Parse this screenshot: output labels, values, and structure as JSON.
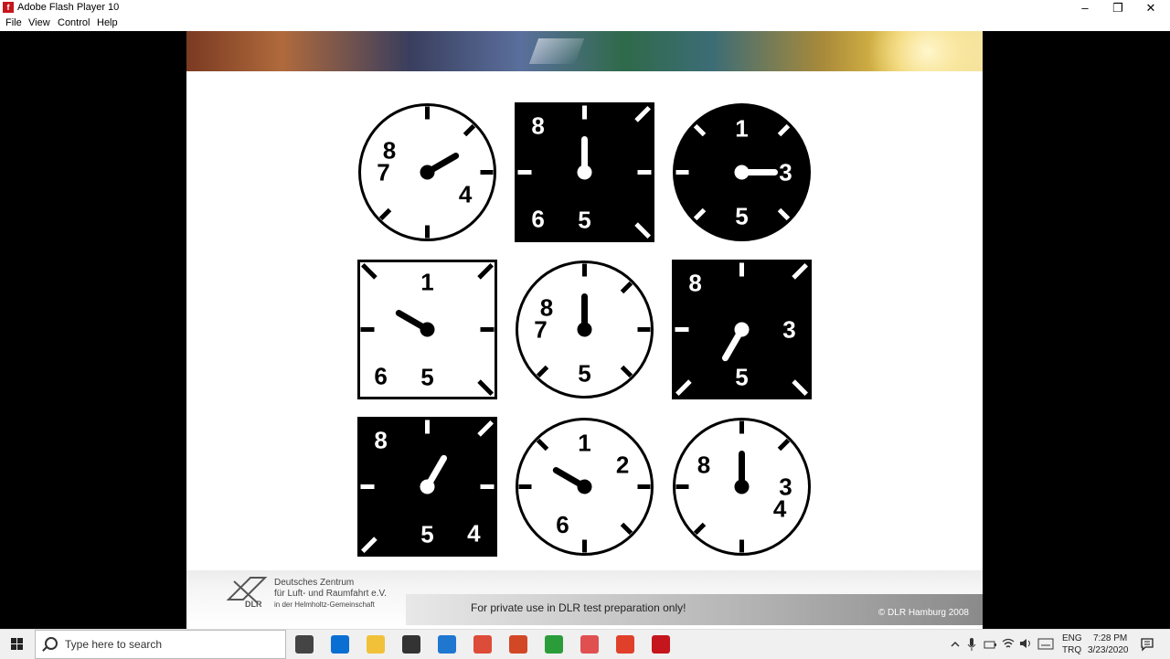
{
  "window": {
    "title": "Adobe Flash Player 10",
    "minimize": "–",
    "restore": "❐",
    "close": "✕"
  },
  "menu": {
    "items": [
      "File",
      "View",
      "Control",
      "Help"
    ]
  },
  "clocks": [
    {
      "shape": "round",
      "theme": "white",
      "numbers": [
        {
          "label": "8",
          "pos": 10
        },
        {
          "label": "7",
          "pos": 9
        },
        {
          "label": "4",
          "pos": 4
        }
      ],
      "hand": 2
    },
    {
      "shape": "square",
      "theme": "black",
      "numbers": [
        {
          "label": "8",
          "pos": 10.5
        },
        {
          "label": "6",
          "pos": 7.5
        },
        {
          "label": "5",
          "pos": 6
        }
      ],
      "hand": 12
    },
    {
      "shape": "round",
      "theme": "black",
      "numbers": [
        {
          "label": "1",
          "pos": 12
        },
        {
          "label": "3",
          "pos": 3
        },
        {
          "label": "5",
          "pos": 6
        }
      ],
      "hand": 3
    },
    {
      "shape": "square",
      "theme": "white",
      "numbers": [
        {
          "label": "1",
          "pos": 12
        },
        {
          "label": "6",
          "pos": 7.5
        },
        {
          "label": "5",
          "pos": 6
        }
      ],
      "hand": 10
    },
    {
      "shape": "round",
      "theme": "white",
      "numbers": [
        {
          "label": "8",
          "pos": 10
        },
        {
          "label": "7",
          "pos": 9
        },
        {
          "label": "5",
          "pos": 6
        }
      ],
      "hand": 12
    },
    {
      "shape": "square",
      "theme": "black",
      "numbers": [
        {
          "label": "8",
          "pos": 10.5
        },
        {
          "label": "3",
          "pos": 3
        },
        {
          "label": "5",
          "pos": 6
        }
      ],
      "hand": 7
    },
    {
      "shape": "square",
      "theme": "black",
      "numbers": [
        {
          "label": "8",
          "pos": 10.5
        },
        {
          "label": "5",
          "pos": 6
        },
        {
          "label": "4",
          "pos": 4.5
        }
      ],
      "hand": 1
    },
    {
      "shape": "round",
      "theme": "white",
      "numbers": [
        {
          "label": "1",
          "pos": 12
        },
        {
          "label": "2",
          "pos": 2
        },
        {
          "label": "6",
          "pos": 7
        }
      ],
      "hand": 10
    },
    {
      "shape": "round",
      "theme": "white",
      "numbers": [
        {
          "label": "8",
          "pos": 10
        },
        {
          "label": "3",
          "pos": 3
        },
        {
          "label": "4",
          "pos": 4
        }
      ],
      "hand": 12
    }
  ],
  "footer": {
    "org_line1": "Deutsches Zentrum",
    "org_line2": "für Luft- und Raumfahrt e.V.",
    "org_line3": "in der Helmholtz-Gemeinschaft",
    "logo_text": "DLR",
    "notice": "For private use in DLR test preparation only!",
    "copyright": "© DLR Hamburg 2008"
  },
  "taskbar": {
    "search_placeholder": "Type here to search",
    "apps": [
      {
        "name": "task-view",
        "color": "#444444"
      },
      {
        "name": "edge",
        "color": "#0a6fd3"
      },
      {
        "name": "file-explorer",
        "color": "#f2c13a"
      },
      {
        "name": "store",
        "color": "#333333"
      },
      {
        "name": "mail",
        "color": "#1f77d0"
      },
      {
        "name": "chrome",
        "color": "#dd4b39"
      },
      {
        "name": "powerpoint",
        "color": "#d24726"
      },
      {
        "name": "camtasia",
        "color": "#2a9d3a"
      },
      {
        "name": "snipping",
        "color": "#e05050"
      },
      {
        "name": "creative-cloud",
        "color": "#e0402a"
      },
      {
        "name": "flash-player",
        "color": "#c4161c"
      }
    ],
    "lang1": "ENG",
    "lang2": "TRQ",
    "time": "7:28 PM",
    "date": "3/23/2020"
  }
}
